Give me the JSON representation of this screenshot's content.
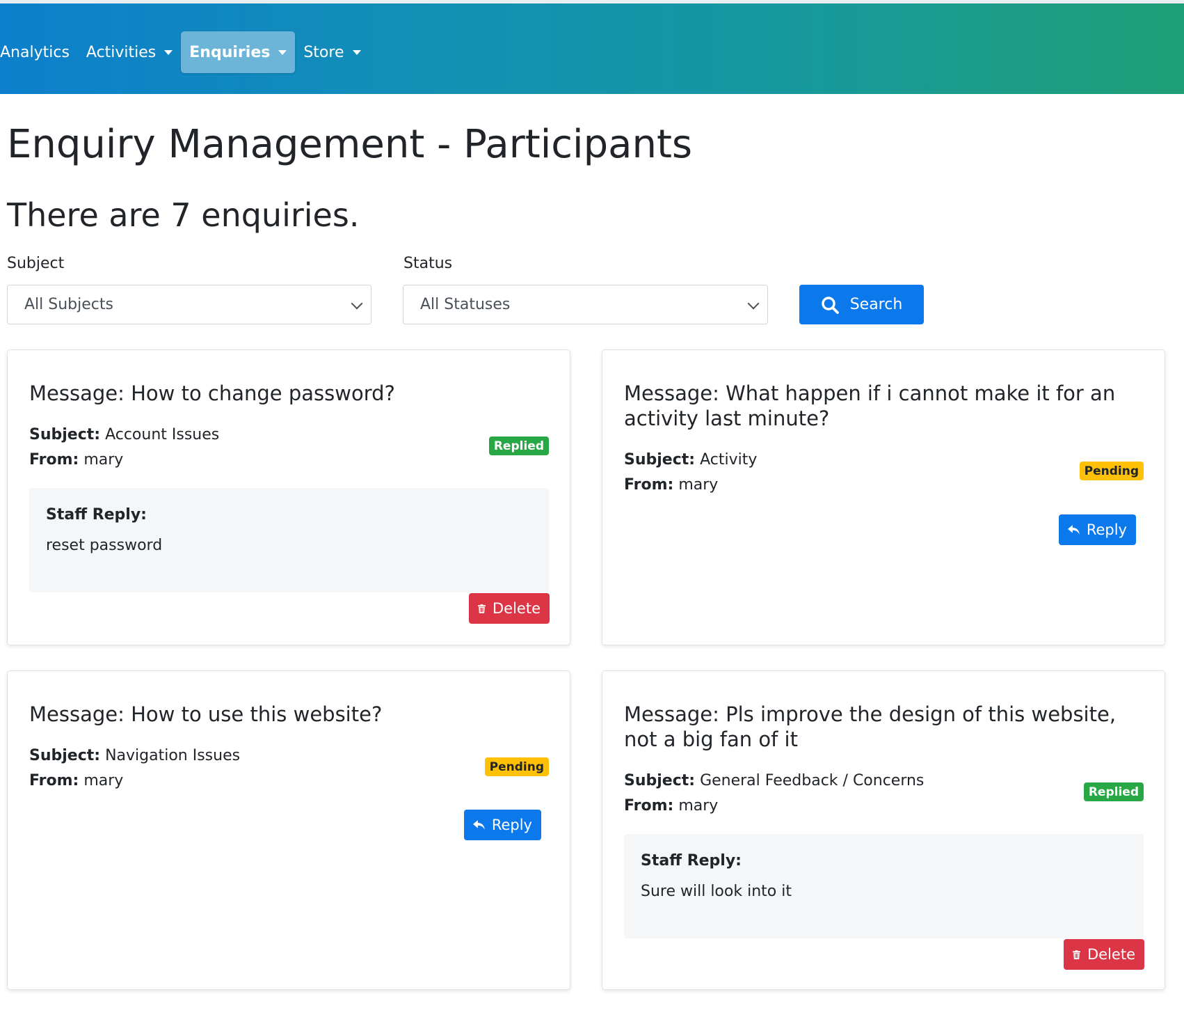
{
  "nav": {
    "items": [
      {
        "label": "Analytics",
        "dropdown": false,
        "active": false
      },
      {
        "label": "Activities",
        "dropdown": true,
        "active": false
      },
      {
        "label": "Enquiries",
        "dropdown": true,
        "active": true
      },
      {
        "label": "Store",
        "dropdown": true,
        "active": false
      }
    ]
  },
  "page": {
    "title": "Enquiry Management - Participants",
    "count_text": "There are 7 enquiries."
  },
  "filters": {
    "subject_label": "Subject",
    "subject_value": "All Subjects",
    "status_label": "Status",
    "status_value": "All Statuses",
    "search_label": "Search"
  },
  "labels": {
    "message_prefix": "Message:",
    "subject_prefix": "Subject:",
    "from_prefix": "From:",
    "staff_reply": "Staff Reply:",
    "delete": "Delete",
    "reply": "Reply"
  },
  "enquiries": [
    {
      "message": "How to change password?",
      "subject": "Account Issues",
      "from": "mary",
      "status": "Replied",
      "reply": "reset password"
    },
    {
      "message": "What happen if i cannot make it for an activity last minute?",
      "subject": "Activity",
      "from": "mary",
      "status": "Pending",
      "reply": ""
    },
    {
      "message": "How to use this website?",
      "subject": "Navigation Issues",
      "from": "mary",
      "status": "Pending",
      "reply": ""
    },
    {
      "message": "Pls improve the design of this website, not a big fan of it",
      "subject": "General Feedback / Concerns",
      "from": "mary",
      "status": "Replied",
      "reply": "Sure will look into it"
    }
  ],
  "colors": {
    "primary": "#0b79ec",
    "danger": "#dc3545",
    "success": "#28a745",
    "warning": "#ffc107"
  }
}
